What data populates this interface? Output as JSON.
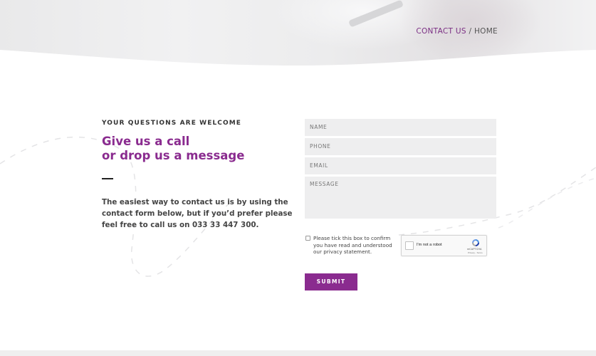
{
  "breadcrumb": {
    "link": "CONTACT US",
    "separator": " / ",
    "current": "HOME"
  },
  "intro_section": {
    "kicker": "YOUR QUESTIONS ARE WELCOME",
    "headline_line1": "Give us a call",
    "headline_line2": "or drop us a message",
    "body": "The easiest way to contact us is by using the contact form below, but if you’d prefer please feel free to call us on 033 33 447 300."
  },
  "form": {
    "name_placeholder": "NAME",
    "phone_placeholder": "PHONE",
    "email_placeholder": "EMAIL",
    "message_placeholder": "MESSAGE",
    "consent_text": "Please tick this box to confirm you have read and understood our privacy statement.",
    "submit_label": "SUBMIT"
  },
  "recaptcha": {
    "label": "I'm not a robot",
    "brand": "reCAPTCHA",
    "terms": "Privacy - Terms"
  },
  "colors": {
    "accent": "#8a2b8f",
    "field_bg": "#eeeeef"
  }
}
